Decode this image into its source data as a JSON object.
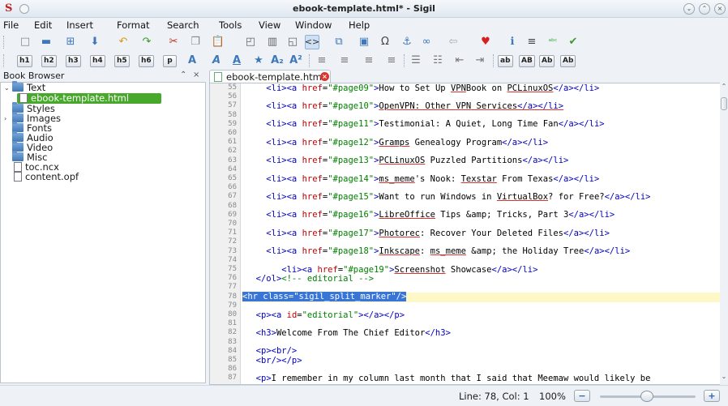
{
  "window": {
    "title": "ebook-template.html* - Sigil",
    "logo_glyph": "S"
  },
  "menu": [
    "File",
    "Edit",
    "Insert",
    "Format",
    "Search",
    "Tools",
    "View",
    "Window",
    "Help"
  ],
  "toolbar2": {
    "headings": [
      "h1",
      "h2",
      "h3",
      "h4",
      "h5",
      "h6",
      "p"
    ],
    "case_buttons": [
      "ab",
      "AB",
      "Ab",
      "Ab"
    ]
  },
  "book_browser": {
    "title": "Book Browser",
    "float_glyph": "⌃",
    "close_glyph": "×",
    "tree": [
      {
        "label": "Text",
        "type": "folder",
        "expanded": true
      },
      {
        "label": "ebook-template.html",
        "type": "file",
        "selected": true
      },
      {
        "label": "Styles",
        "type": "folder"
      },
      {
        "label": "Images",
        "type": "folder",
        "collapsed": true
      },
      {
        "label": "Fonts",
        "type": "folder"
      },
      {
        "label": "Audio",
        "type": "folder"
      },
      {
        "label": "Video",
        "type": "folder"
      },
      {
        "label": "Misc",
        "type": "folder"
      },
      {
        "label": "toc.ncx",
        "type": "file"
      },
      {
        "label": "content.opf",
        "type": "file"
      }
    ]
  },
  "editor": {
    "tab_label": "ebook-template.html",
    "current_line": 78,
    "line_numbers": [
      "55",
      "56",
      "57",
      "58",
      "59",
      "60",
      "61",
      "62",
      "63",
      "64",
      "65",
      "66",
      "67",
      "68",
      "69",
      "70",
      "71",
      "72",
      "73",
      "74",
      "75",
      "76",
      "77",
      "78",
      "79",
      "80",
      "81",
      "82",
      "83",
      "84",
      "85",
      "86",
      "87"
    ],
    "code": {
      "55": "How to Set Up VPNBook on PCLinuxOS",
      "57": "OpenVPN: Other VPN Services",
      "59": "Testimonial: A Quiet, Long Time Fan",
      "61": "Gramps Genealogy Program",
      "63": "PCLinuxOS Puzzled Partitions",
      "65": "ms_meme's Nook: Texstar From Texas",
      "67": "Want to run Windows in VirtualBox? for Free?",
      "69": "LibreOffice Tips &amp; Tricks, Part 3",
      "71": "Photorec: Recover Your Deleted Files",
      "73": "Inkscape: ms_meme &amp; the Holiday Tree",
      "75": "Screenshot Showcase",
      "76": "</ol><!-- editorial -->",
      "78": "<hr class=\"sigil_split_marker\" />",
      "80": "<p><a id=\"editorial\"></a></p>",
      "82": "<h3>Welcome From The Chief Editor</h3>",
      "84": "<p><br />",
      "85": "<br /></p>",
      "87": "<p>I remember in my column last month that I said that Meemaw would likely be"
    },
    "hrefs": {
      "55": "#page09",
      "57": "#page10",
      "59": "#page11",
      "61": "#page12",
      "63": "#page13",
      "65": "#page14",
      "67": "#page15",
      "69": "#page16",
      "71": "#page17",
      "73": "#page18",
      "75": "#page19"
    }
  },
  "status": {
    "position": "Line: 78, Col: 1",
    "zoom": "100%",
    "zoom_percent": 100
  }
}
